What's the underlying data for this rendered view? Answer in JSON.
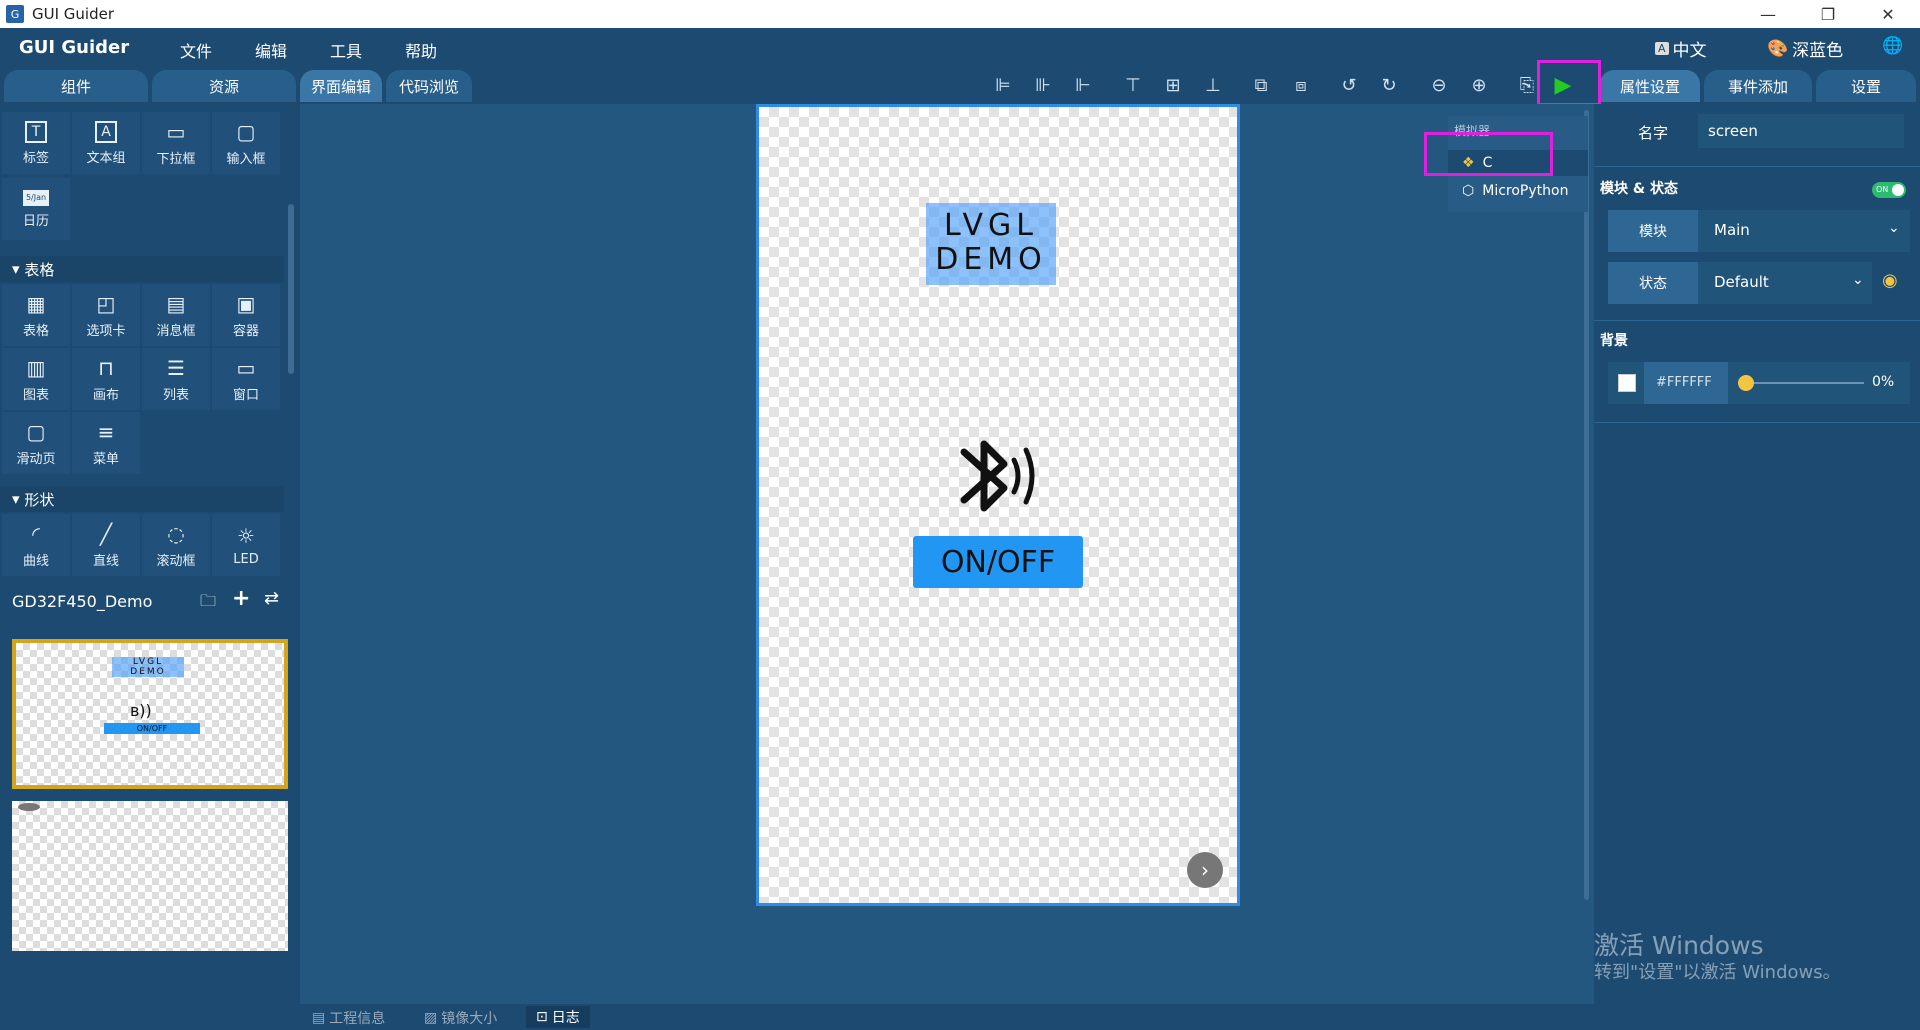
{
  "window": {
    "title": "GUI Guider"
  },
  "menubar": {
    "brand": "GUI Guider",
    "items": [
      "文件",
      "编辑",
      "工具",
      "帮助"
    ],
    "language": "中文",
    "theme": "深蓝色"
  },
  "left_tabs": [
    "组件",
    "资源"
  ],
  "center_tabs": [
    "界面编辑",
    "代码浏览"
  ],
  "right_tabs": [
    "属性设置",
    "事件添加",
    "设置"
  ],
  "widgets": {
    "basic": [
      {
        "icon": "text-icon",
        "glyph": "T",
        "label": "标签"
      },
      {
        "icon": "text-group-icon",
        "glyph": "A",
        "label": "文本组"
      },
      {
        "icon": "dropdown-icon",
        "glyph": "▭",
        "label": "下拉框"
      },
      {
        "icon": "input-icon",
        "glyph": "▢",
        "label": "输入框"
      },
      {
        "icon": "calendar-icon",
        "glyph": "5/Jan",
        "label": "日历"
      }
    ],
    "table_section": "表格",
    "tables": [
      {
        "icon": "table-icon",
        "glyph": "▦",
        "label": "表格"
      },
      {
        "icon": "tabview-icon",
        "glyph": "◰",
        "label": "选项卡"
      },
      {
        "icon": "msgbox-icon",
        "glyph": "▤",
        "label": "消息框"
      },
      {
        "icon": "container-icon",
        "glyph": "▣",
        "label": "容器"
      },
      {
        "icon": "chart-icon",
        "glyph": "▥",
        "label": "图表"
      },
      {
        "icon": "canvas-icon",
        "glyph": "⊓",
        "label": "画布"
      },
      {
        "icon": "list-icon",
        "glyph": "☰",
        "label": "列表"
      },
      {
        "icon": "window-icon",
        "glyph": "▭",
        "label": "窗口"
      },
      {
        "icon": "tileview-icon",
        "glyph": "▢",
        "label": "滑动页"
      },
      {
        "icon": "menu-icon",
        "glyph": "≡",
        "label": "菜单"
      }
    ],
    "shape_section": "形状",
    "shapes": [
      {
        "icon": "arc-icon",
        "glyph": "◜",
        "label": "曲线"
      },
      {
        "icon": "line-icon",
        "glyph": "╱",
        "label": "直线"
      },
      {
        "icon": "spinner-icon",
        "glyph": "◌",
        "label": "滚动框"
      },
      {
        "icon": "led-icon",
        "glyph": "☼",
        "label": "LED"
      }
    ]
  },
  "project": {
    "name": "GD32F450_Demo"
  },
  "thumbnail": {
    "title_line1": "LVGL",
    "title_line2": "DEMO",
    "button": "ON/OFF"
  },
  "screen": {
    "title_line1": "LVGL",
    "title_line2": "DEMO",
    "button_label": "ON/OFF"
  },
  "simulator_menu": {
    "header": "模拟器",
    "options": [
      "C",
      "MicroPython"
    ]
  },
  "properties": {
    "name_label": "名字",
    "name_value": "screen",
    "module_state_title": "模块 & 状态",
    "toggle_text": "ON",
    "module_label": "模块",
    "module_value": "Main",
    "state_label": "状态",
    "state_value": "Default",
    "background_title": "背景",
    "bg_color": "#FFFFFF",
    "bg_opacity": "0%"
  },
  "bottom_tabs": [
    "工程信息",
    "镜像大小",
    "日志"
  ],
  "watermark": {
    "line1": "激活 Windows",
    "line2": "转到\"设置\"以激活 Windows。"
  },
  "colors": {
    "accent": "#2196f3",
    "panel": "#1c4a70",
    "canvas_bg": "#24577f",
    "highlight": "#e020e0",
    "run": "#22cc22"
  }
}
